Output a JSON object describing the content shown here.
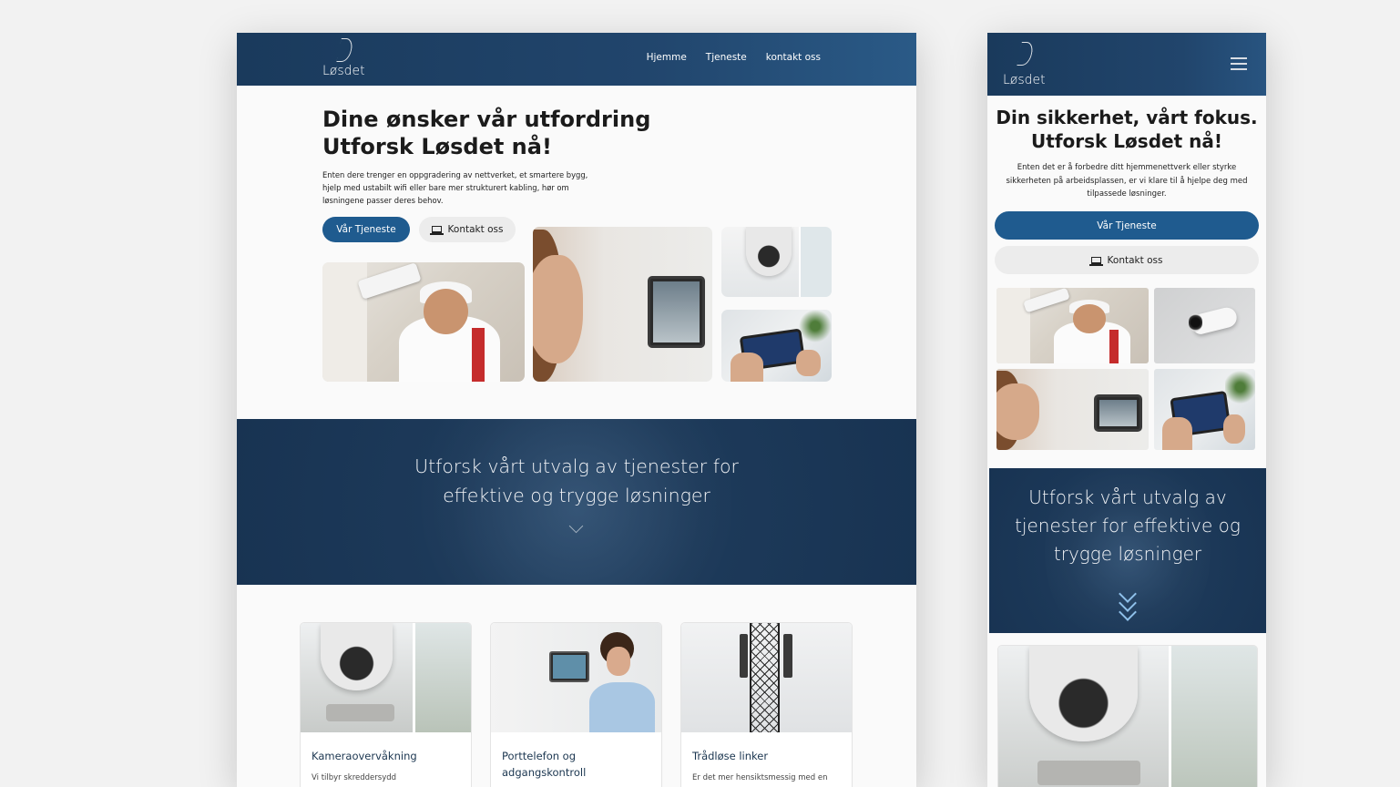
{
  "brand": {
    "name": "Løsdet",
    "primary_color": "#1f5b8f",
    "header_color": "#1a3a5c"
  },
  "desktop": {
    "nav": [
      "Hjemme",
      "Tjeneste",
      "kontakt oss"
    ],
    "hero": {
      "title_line1": "Dine ønsker vår utfordring",
      "title_line2": "Utforsk Løsdet nå!",
      "text": "Enten dere trenger en oppgradering av nettverket, et smartere bygg, hjelp med ustabilt wifi eller bare mer strukturert kabling, hør om løsningene passer deres behov.",
      "primary_button": "Vår Tjeneste",
      "secondary_button": "Kontakt oss",
      "secondary_icon": "laptop-icon"
    },
    "band": {
      "text_line1": "Utforsk vårt utvalg av tjenester for",
      "text_line2": "effektive og trygge løsninger"
    },
    "cards": [
      {
        "title": "Kameraovervåkning",
        "desc": "Vi tilbyr skreddersydd"
      },
      {
        "title": "Porttelefon og adgangskontroll",
        "desc": ""
      },
      {
        "title": "Trådløse linker",
        "desc": "Er det mer hensiktsmessig med en"
      }
    ]
  },
  "mobile": {
    "hero": {
      "title_line1": "Din sikkerhet, vårt fokus.",
      "title_line2": "Utforsk Løsdet nå!",
      "text": "Enten det er å forbedre ditt hjemmenettverk eller styrke sikkerheten på arbeidsplassen, er vi klare til å hjelpe deg med tilpassede løsninger.",
      "primary_button": "Vår Tjeneste",
      "secondary_button": "Kontakt oss"
    },
    "band": {
      "text": "Utforsk vårt utvalg av tjenester for effektive og trygge løsninger"
    }
  }
}
